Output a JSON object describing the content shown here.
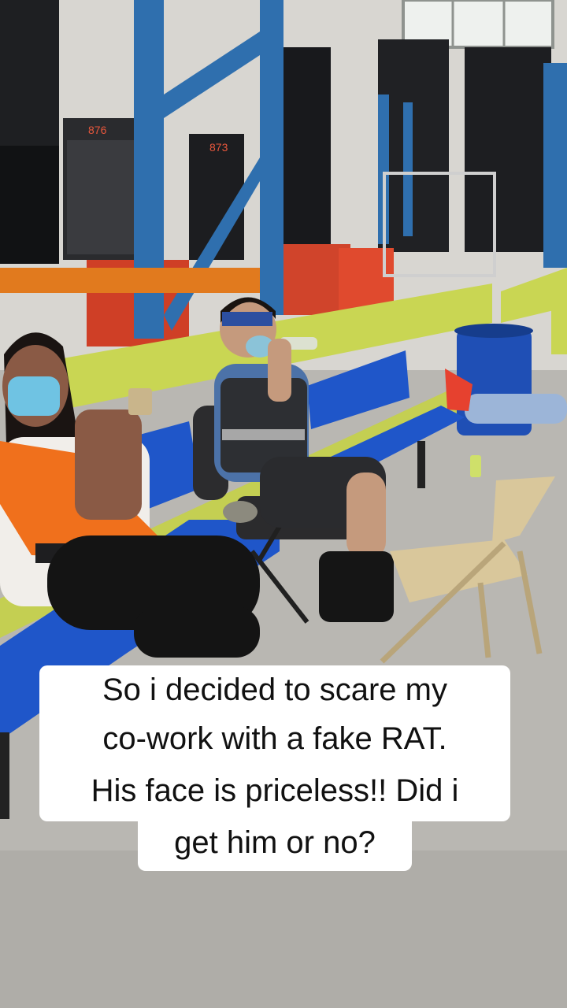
{
  "caption": {
    "lines": [
      "So i decided to scare my",
      "co-work with a fake RAT.",
      "His face is priceless!! Did i",
      "get him or no?"
    ],
    "background_color": "#ffffff",
    "text_color": "#111111"
  },
  "scene": {
    "shelf_labels": [
      "876",
      "873"
    ]
  },
  "colors": {
    "floor": "#b9b7b2",
    "bench_blue": "#1f56c9",
    "rack_blue": "#2f6fae",
    "guard_rail": "#c9d653",
    "beam_orange": "#e17a1e",
    "vest_orange": "#f0701c",
    "chair_tan": "#d9c79b"
  }
}
